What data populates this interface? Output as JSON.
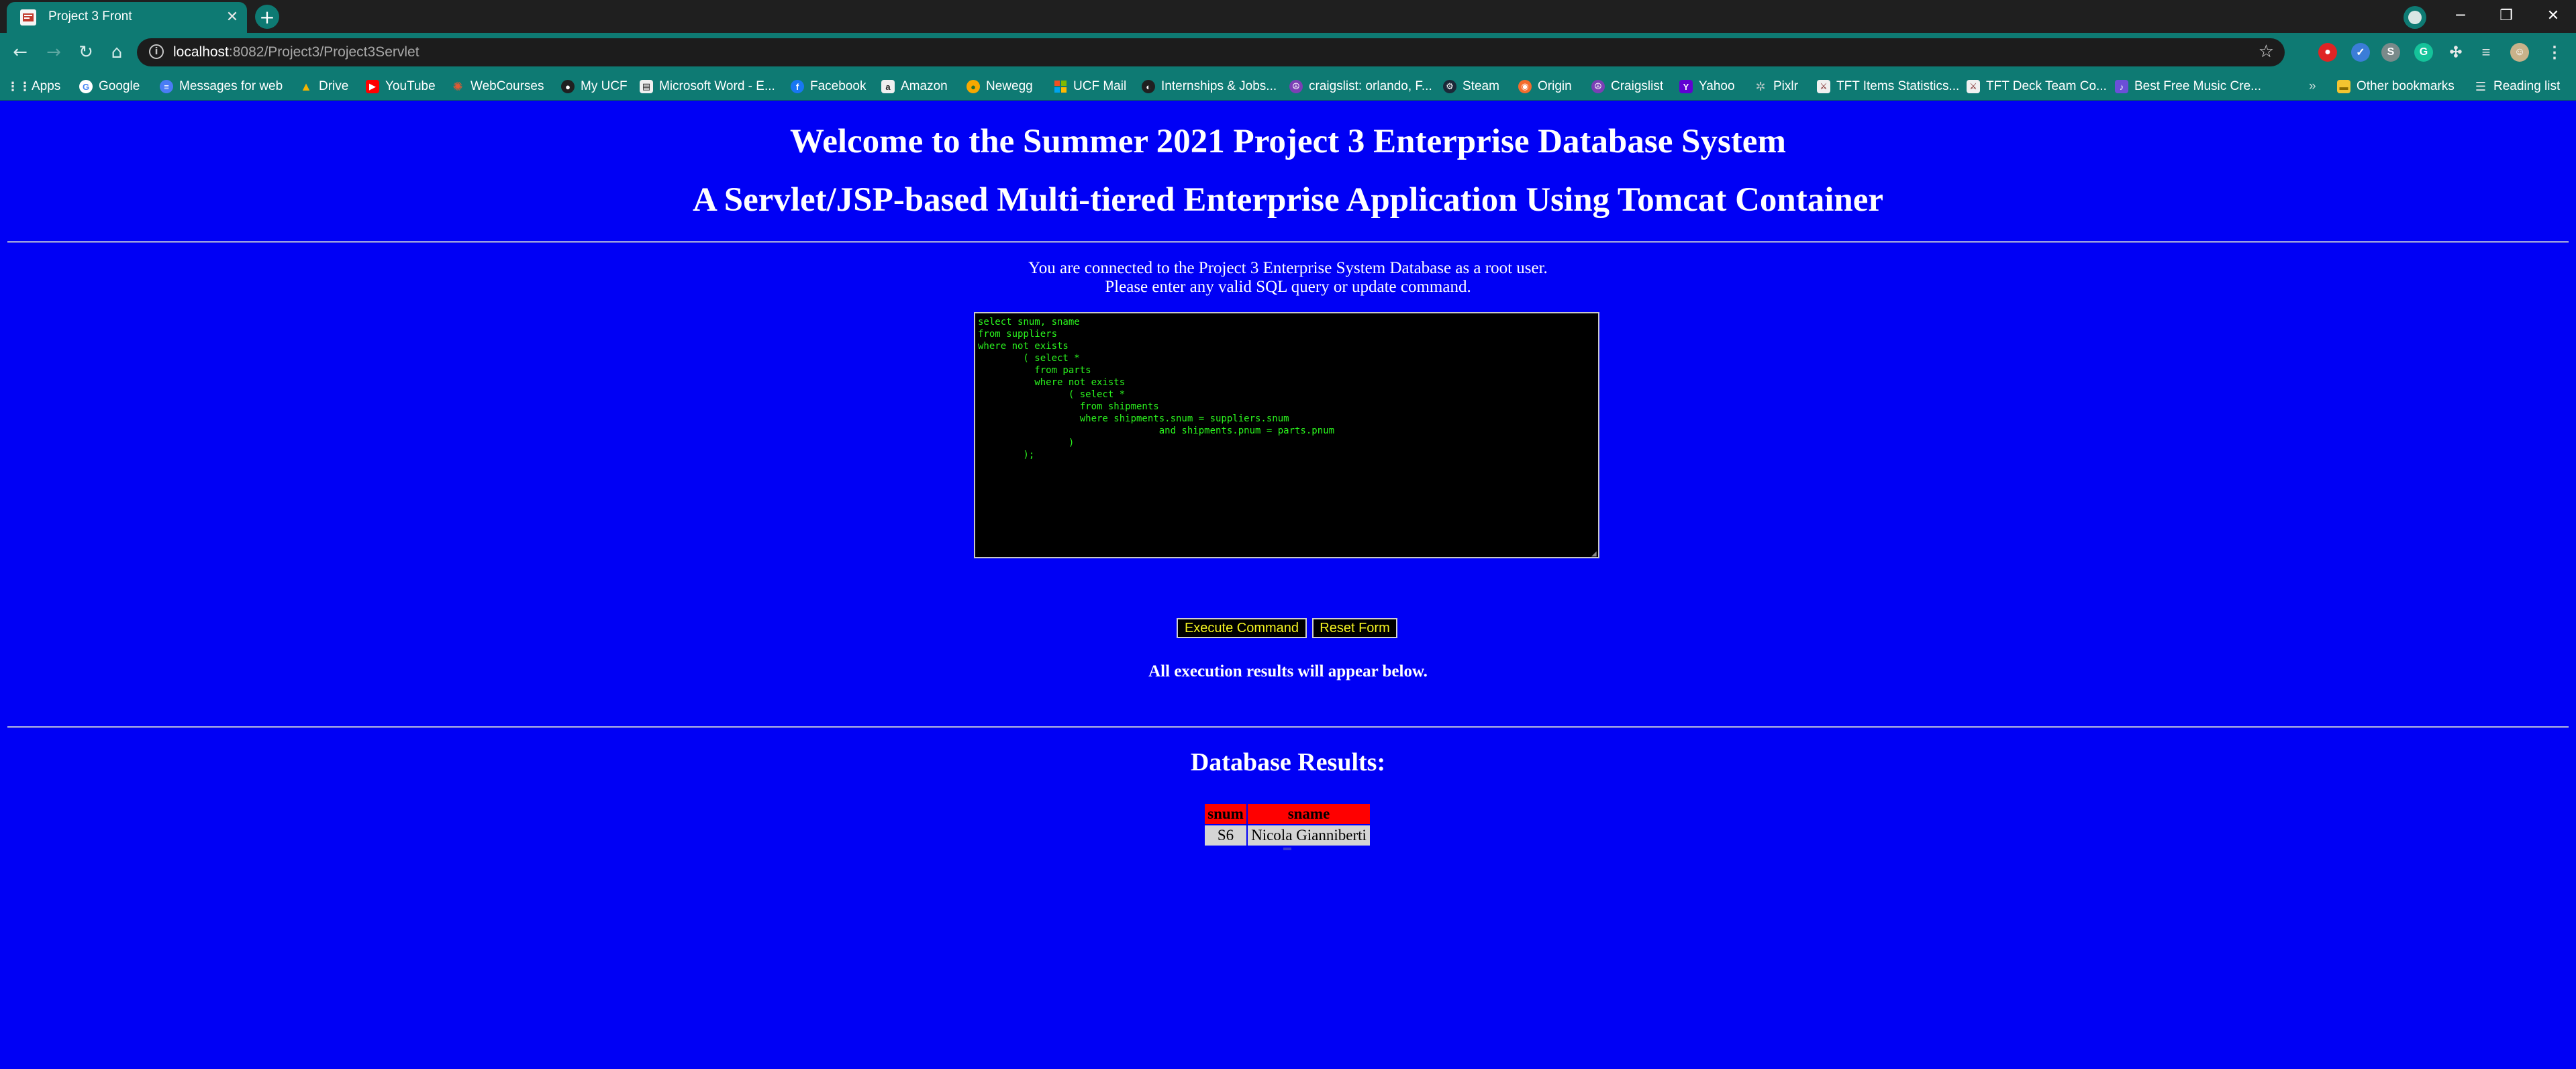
{
  "browser": {
    "tab_title": "Project 3 Front",
    "url_host": "localhost",
    "url_rest": ":8082/Project3/Project3Servlet",
    "bookmarks": [
      {
        "label": "Apps",
        "icon": "apps-grid-icon",
        "color": "#e8e8e8"
      },
      {
        "label": "Google",
        "icon": "google-icon",
        "color": "#ffffff"
      },
      {
        "label": "Messages for web",
        "icon": "messages-icon",
        "color": "#4a7cf5"
      },
      {
        "label": "Drive",
        "icon": "drive-icon",
        "color": "#f4b400"
      },
      {
        "label": "YouTube",
        "icon": "youtube-icon",
        "color": "#ff0000"
      },
      {
        "label": "WebCourses",
        "icon": "webcourses-icon",
        "color": "#e35a33"
      },
      {
        "label": "My UCF",
        "icon": "ucf-icon",
        "color": "#202020"
      },
      {
        "label": "Microsoft Word - E...",
        "icon": "document-icon",
        "color": "#f0f0f0"
      },
      {
        "label": "Facebook",
        "icon": "facebook-icon",
        "color": "#1877f2"
      },
      {
        "label": "Amazon",
        "icon": "amazon-icon",
        "color": "#f0f0f0"
      },
      {
        "label": "Newegg",
        "icon": "newegg-icon",
        "color": "#f7a800"
      },
      {
        "label": "UCF Mail",
        "icon": "microsoft-icon",
        "color": "#f25022"
      },
      {
        "label": "Internships & Jobs...",
        "icon": "jobs-icon",
        "color": "#202020"
      },
      {
        "label": "craigslist: orlando, F...",
        "icon": "peace-icon",
        "color": "#7b3fb5"
      },
      {
        "label": "Steam",
        "icon": "steam-icon",
        "color": "#1b2838"
      },
      {
        "label": "Origin",
        "icon": "origin-icon",
        "color": "#f56c2d"
      },
      {
        "label": "Craigslist",
        "icon": "peace-icon",
        "color": "#7b3fb5"
      },
      {
        "label": "Yahoo",
        "icon": "yahoo-icon",
        "color": "#6001d2"
      },
      {
        "label": "Pixlr",
        "icon": "pixlr-icon",
        "color": "#2a9d8f"
      },
      {
        "label": "TFT Items Statistics...",
        "icon": "tft-icon",
        "color": "#f0f0f0"
      },
      {
        "label": "TFT Deck Team Co...",
        "icon": "tft-icon",
        "color": "#f0f0f0"
      },
      {
        "label": "Best Free Music Cre...",
        "icon": "music-icon",
        "color": "#6b4fd8"
      }
    ],
    "other_bookmarks": "Other bookmarks",
    "reading_list": "Reading list"
  },
  "page": {
    "title_line1": "Welcome to the Summer 2021 Project 3 Enterprise Database System",
    "title_line2": "A Servlet/JSP-based Multi-tiered Enterprise Application Using Tomcat Container",
    "intro_line1": "You are connected to the Project 3 Enterprise System Database as a root user.",
    "intro_line2": "Please enter any valid SQL query or update command.",
    "sql_text": "select snum, sname\nfrom suppliers\nwhere not exists\n        ( select *\n          from parts\n          where not exists\n                ( select *\n                  from shipments\n                  where shipments.snum = suppliers.snum\n                                and shipments.pnum = parts.pnum\n                )\n        );",
    "execute_label": "Execute Command",
    "reset_label": "Reset Form",
    "results_note": "All execution results will appear below.",
    "results_heading": "Database Results:",
    "table": {
      "columns": [
        "snum",
        "sname"
      ],
      "rows": [
        [
          "S6",
          "Nicola Gianniberti"
        ]
      ]
    }
  },
  "colors": {
    "page_bg": "#0000f5",
    "chrome_teal": "#0e7a73",
    "sql_text": "#2bf51e",
    "button_text": "#f5f520",
    "header_cell": "#ff0000",
    "data_cell": "#d4d4d4"
  }
}
